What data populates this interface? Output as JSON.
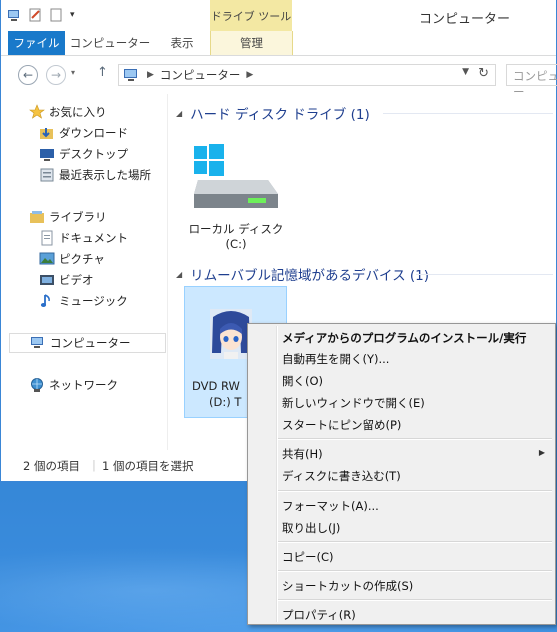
{
  "window": {
    "title": "コンピューター",
    "contextual_tab_group": "ドライブ ツール"
  },
  "ribbon": {
    "tabs": [
      {
        "label": "ファイル"
      },
      {
        "label": "コンピューター"
      },
      {
        "label": "表示"
      },
      {
        "label": "管理"
      }
    ]
  },
  "address": {
    "path": "コンピューター",
    "search_placeholder": "コンピュー"
  },
  "nav": {
    "favorites": "お気に入り",
    "favorite_items": [
      "ダウンロード",
      "デスクトップ",
      "最近表示した場所"
    ],
    "libraries": "ライブラリ",
    "library_items": [
      "ドキュメント",
      "ピクチャ",
      "ビデオ",
      "ミュージック"
    ],
    "computer": "コンピューター",
    "network": "ネットワーク"
  },
  "content": {
    "hdd_group": "ハード ディスク ドライブ (1)",
    "local_disk_line1": "ローカル ディスク",
    "local_disk_line2": "(C:)",
    "removable_group": "リムーバブル記憶域があるデバイス (1)",
    "dvd_line1": "DVD RW",
    "dvd_line2": "(D:) T"
  },
  "status": {
    "items_count": "2 個の項目",
    "selected": "1 個の項目を選択"
  },
  "context_menu": {
    "items": [
      {
        "label": "メディアからのプログラムのインストール/実行",
        "bold": true
      },
      {
        "label": "自動再生を開く(Y)..."
      },
      {
        "label": "開く(O)"
      },
      {
        "label": "新しいウィンドウで開く(E)"
      },
      {
        "label": "スタートにピン留め(P)"
      },
      {
        "label": "共有(H)",
        "submenu": true
      },
      {
        "label": "ディスクに書き込む(T)"
      },
      {
        "label": "フォーマット(A)..."
      },
      {
        "label": "取り出し(J)"
      },
      {
        "label": "コピー(C)"
      },
      {
        "label": "ショートカットの作成(S)"
      },
      {
        "label": "プロパティ(R)"
      }
    ]
  },
  "colors": {
    "accent": "#1979ca",
    "desktop": "#2f7ecf",
    "contextual_tab": "#f3e8a3",
    "selection": "#cce8ff"
  }
}
